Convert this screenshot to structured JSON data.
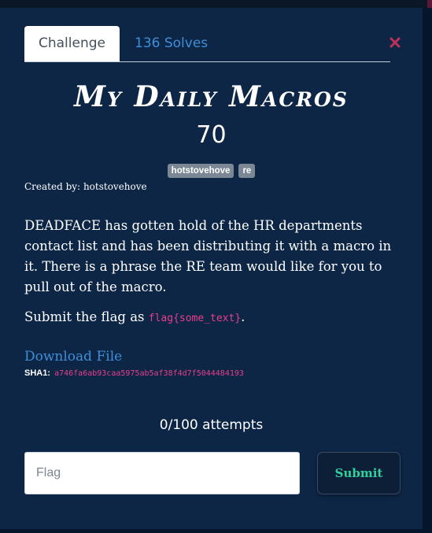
{
  "tabs": {
    "challenge_label": "Challenge",
    "solves_label": "136 Solves"
  },
  "challenge": {
    "title": "My Daily Macros",
    "points": "70",
    "tags": [
      "hotstovehove",
      "re"
    ],
    "created_by_label": "Created by:",
    "created_by": "hotstovehove",
    "description": "DEADFACE has gotten hold of the HR departments contact list and has been distributing it with a macro in it. There is a phrase the RE team would like for you to pull out of the macro.",
    "submit_text_before": "Submit the flag as ",
    "flag_format": "flag{some_text}",
    "submit_text_after": ".",
    "download_label": "Download File",
    "sha1_label": "SHA1:",
    "sha1_value": "a746fa6ab93caa5975ab5af38f4d7f5044484193"
  },
  "attempts": "0/100 attempts",
  "form": {
    "flag_placeholder": "Flag",
    "submit_label": "Submit"
  },
  "icons": {
    "close": "close-icon"
  },
  "colors": {
    "link": "#3e8ed8",
    "code": "#e83e8c",
    "submit_text": "#2fd1a0",
    "modal_bg": "#0d2646",
    "close_icon": "#c0305a"
  }
}
